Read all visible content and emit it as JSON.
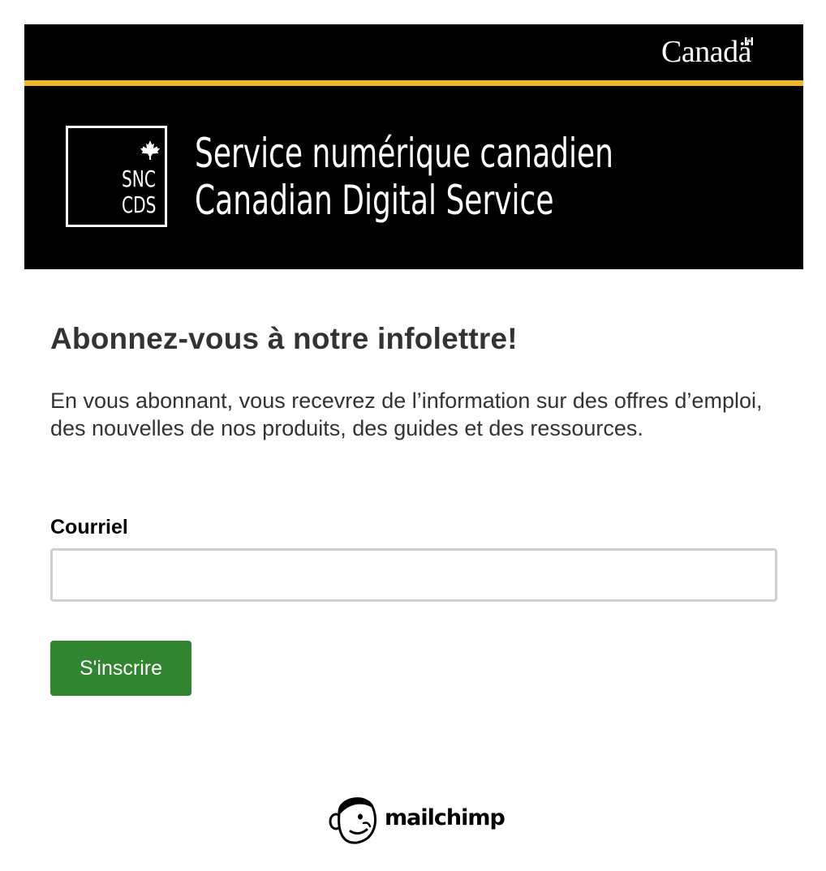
{
  "banner": {
    "wordmark": "Canadä",
    "logo_line1": "SNC",
    "logo_line2": "CDS",
    "service_name_fr": "Service numérique canadien",
    "service_name_en": "Canadian Digital Service",
    "colors": {
      "background": "#000000",
      "stripe": "#f3b72c",
      "flag": "#ffffff"
    }
  },
  "form": {
    "title": "Abonnez-vous à notre infolettre!",
    "intro": "En vous abonnant, vous recevrez de l’information sur des offres d’emploi, des nouvelles de nos produits, des guides et des ressources.",
    "email_label": "Courriel",
    "email_value": "",
    "email_placeholder": "",
    "submit_label": "S'inscrire",
    "colors": {
      "button": "#318430",
      "text": "#333333"
    }
  },
  "footer": {
    "brand": "mailchimp",
    "icon": "mailchimp-freddie-icon"
  }
}
